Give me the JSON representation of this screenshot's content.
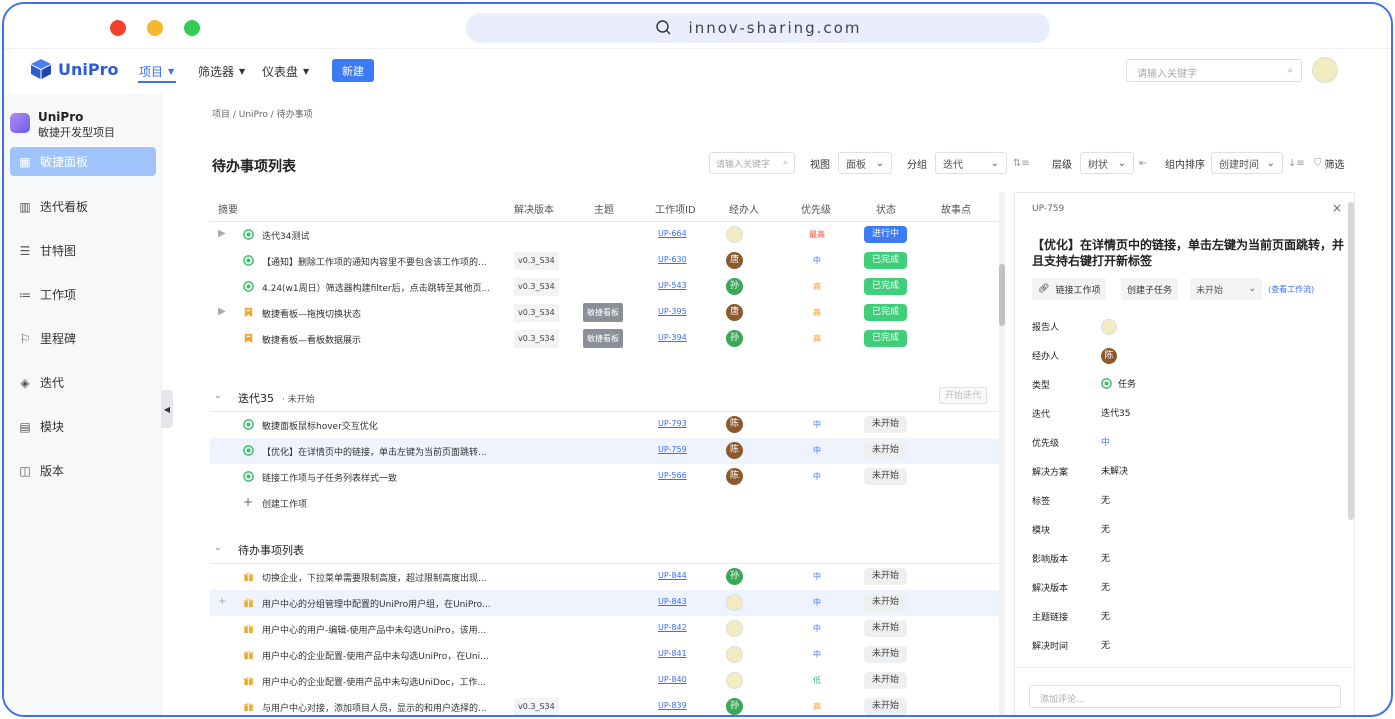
{
  "browser": {
    "url": "innov-sharing.com"
  },
  "app": {
    "logo_text": "UniPro",
    "nav": [
      {
        "label": "项目",
        "active": true
      },
      {
        "label": "筛选器",
        "active": false
      },
      {
        "label": "仪表盘",
        "active": false
      }
    ],
    "new_button": "新建",
    "search_placeholder": "请输入关键字"
  },
  "sidebar": {
    "project_name": "UniPro",
    "project_sub": "敏捷开发型项目",
    "items": [
      {
        "label": "敏捷面板",
        "icon": "board-icon",
        "active": true
      },
      {
        "label": "迭代看板",
        "icon": "kanban-icon",
        "active": false
      },
      {
        "label": "甘特图",
        "icon": "gantt-icon",
        "active": false
      },
      {
        "label": "工作项",
        "icon": "list-icon",
        "active": false
      },
      {
        "label": "里程碑",
        "icon": "flag-icon",
        "active": false
      },
      {
        "label": "迭代",
        "icon": "layers-icon",
        "active": false
      },
      {
        "label": "模块",
        "icon": "module-icon",
        "active": false
      },
      {
        "label": "版本",
        "icon": "version-icon",
        "active": false
      }
    ]
  },
  "main": {
    "breadcrumb": "项目 / UniPro / 待办事项",
    "title": "待办事项列表",
    "toolbar": {
      "search_placeholder": "请输入关键字",
      "view_label": "视图",
      "view_value": "面板",
      "group_label": "分组",
      "group_value": "迭代",
      "level_label": "层级",
      "level_value": "树状",
      "sort_label": "组内排序",
      "sort_value": "创建时间",
      "filter_label": "筛选"
    },
    "columns": [
      "摘要",
      "解决版本",
      "主题",
      "工作项ID",
      "经办人",
      "优先级",
      "状态",
      "故事点"
    ],
    "groups": [
      {
        "rows": [
          {
            "expand": "▶",
            "type": "task",
            "summary": "迭代34测试",
            "version": "",
            "theme": "",
            "id": "UP-664",
            "assignee": "",
            "assignee_kind": "emoji",
            "priority": "最高",
            "priority_color": "#f5483b",
            "status": "进行中",
            "status_kind": "progress"
          },
          {
            "expand": "",
            "type": "task",
            "summary": "【通知】删除工作项的通知内容里不要包含该工作项的...",
            "version": "v0.3_S34",
            "theme": "",
            "id": "UP-630",
            "assignee": "唐",
            "assignee_kind": "brown",
            "priority": "中",
            "priority_color": "#3d7af5",
            "status": "已完成",
            "status_kind": "done"
          },
          {
            "expand": "",
            "type": "task",
            "summary": "4.24(w1周日）筛选器构建filter后，点击跳转至其他页...",
            "version": "v0.3_S34",
            "theme": "",
            "id": "UP-543",
            "assignee": "孙",
            "assignee_kind": "green",
            "priority": "高",
            "priority_color": "#f59a23",
            "status": "已完成",
            "status_kind": "done"
          },
          {
            "expand": "▶",
            "type": "story",
            "summary": "敏捷看板—拖拽切换状态",
            "version": "v0.3_S34",
            "theme": "敏捷看板",
            "id": "UP-395",
            "assignee": "唐",
            "assignee_kind": "brown",
            "priority": "高",
            "priority_color": "#f59a23",
            "status": "已完成",
            "status_kind": "done"
          },
          {
            "expand": "",
            "type": "story",
            "summary": "敏捷看板—看板数据展示",
            "version": "v0.3_S34",
            "theme": "敏捷看板",
            "id": "UP-394",
            "assignee": "孙",
            "assignee_kind": "green",
            "priority": "高",
            "priority_color": "#f59a23",
            "status": "已完成",
            "status_kind": "done"
          }
        ]
      },
      {
        "title": "迭代35",
        "subtitle": "· 未开始",
        "action": "开始迭代",
        "rows": [
          {
            "expand": "",
            "type": "task",
            "summary": "敏捷面板鼠标hover交互优化",
            "version": "",
            "theme": "",
            "id": "UP-793",
            "assignee": "陈",
            "assignee_kind": "brown",
            "priority": "中",
            "priority_color": "#3d7af5",
            "status": "未开始",
            "status_kind": "todo"
          },
          {
            "expand": "",
            "type": "task",
            "summary": "【优化】在详情页中的链接，单击左键为当前页面跳转...",
            "version": "",
            "theme": "",
            "id": "UP-759",
            "assignee": "陈",
            "assignee_kind": "brown",
            "priority": "中",
            "priority_color": "#3d7af5",
            "status": "未开始",
            "status_kind": "todo",
            "highlight": true
          },
          {
            "expand": "",
            "type": "task",
            "summary": "链接工作项与子任务列表样式一致",
            "version": "",
            "theme": "",
            "id": "UP-566",
            "assignee": "陈",
            "assignee_kind": "brown",
            "priority": "中",
            "priority_color": "#3d7af5",
            "status": "未开始",
            "status_kind": "todo"
          }
        ],
        "create_label": "创建工作项"
      },
      {
        "title": "待办事项列表",
        "rows": [
          {
            "expand": "",
            "type": "gift",
            "summary": "切换企业，下拉菜单需要限制高度，超过限制高度出现...",
            "version": "",
            "theme": "",
            "id": "UP-844",
            "assignee": "孙",
            "assignee_kind": "green",
            "priority": "中",
            "priority_color": "#3d7af5",
            "status": "未开始",
            "status_kind": "todo"
          },
          {
            "expand": "+",
            "type": "gift",
            "summary": "用户中心的分组管理中配置的UniPro用户组，在UniPro...",
            "version": "",
            "theme": "",
            "id": "UP-843",
            "assignee": "",
            "assignee_kind": "emoji",
            "priority": "中",
            "priority_color": "#3d7af5",
            "status": "未开始",
            "status_kind": "todo",
            "highlight": true
          },
          {
            "expand": "",
            "type": "gift",
            "summary": "用户中心的用户-编辑-使用产品中未勾选UniPro，该用...",
            "version": "",
            "theme": "",
            "id": "UP-842",
            "assignee": "",
            "assignee_kind": "emoji",
            "priority": "中",
            "priority_color": "#3d7af5",
            "status": "未开始",
            "status_kind": "todo"
          },
          {
            "expand": "",
            "type": "gift",
            "summary": "用户中心的企业配置-使用产品中未勾选UniPro，在Uni...",
            "version": "",
            "theme": "",
            "id": "UP-841",
            "assignee": "",
            "assignee_kind": "emoji",
            "priority": "中",
            "priority_color": "#3d7af5",
            "status": "未开始",
            "status_kind": "todo"
          },
          {
            "expand": "",
            "type": "gift",
            "summary": "用户中心的企业配置-使用产品中未勾选UniDoc，工作...",
            "version": "",
            "theme": "",
            "id": "UP-840",
            "assignee": "",
            "assignee_kind": "emoji",
            "priority": "低",
            "priority_color": "#3fbf6a",
            "status": "未开始",
            "status_kind": "todo"
          },
          {
            "expand": "",
            "type": "gift",
            "summary": "与用户中心对接，添加项目人员，显示的和用户选择的...",
            "version": "v0.3_S34",
            "theme": "",
            "id": "UP-839",
            "assignee": "孙",
            "assignee_kind": "green",
            "priority": "高",
            "priority_color": "#f59a23",
            "status": "未开始",
            "status_kind": "todo"
          }
        ]
      }
    ]
  },
  "detail": {
    "id": "UP-759",
    "title": "【优化】在详情页中的链接，单击左键为当前页面跳转，并且支持右键打开新标签",
    "buttons": {
      "link": "链接工作项",
      "subtask": "创建子任务",
      "status": "未开始",
      "view_flow": "(查看工作流)"
    },
    "fields": [
      {
        "label": "报告人",
        "value": "",
        "kind": "emoji-avatar"
      },
      {
        "label": "经办人",
        "value": "陈",
        "kind": "avatar"
      },
      {
        "label": "类型",
        "value": "任务",
        "kind": "type"
      },
      {
        "label": "迭代",
        "value": "迭代35",
        "kind": "text"
      },
      {
        "label": "优先级",
        "value": "中",
        "kind": "prio"
      },
      {
        "label": "解决方案",
        "value": "未解决",
        "kind": "text"
      },
      {
        "label": "标签",
        "value": "无",
        "kind": "text"
      },
      {
        "label": "模块",
        "value": "无",
        "kind": "text"
      },
      {
        "label": "影响版本",
        "value": "无",
        "kind": "text"
      },
      {
        "label": "解决版本",
        "value": "无",
        "kind": "text"
      },
      {
        "label": "主题链接",
        "value": "无",
        "kind": "text"
      },
      {
        "label": "解决时间",
        "value": "无",
        "kind": "text"
      }
    ],
    "comment_placeholder": "添加评论..."
  },
  "colors": {
    "accent": "#3d6ef5",
    "done": "#3fcf7a",
    "progress": "#3d7af5",
    "sidebar_active": "#9fc4fb",
    "frame": "#3d6ef5"
  }
}
